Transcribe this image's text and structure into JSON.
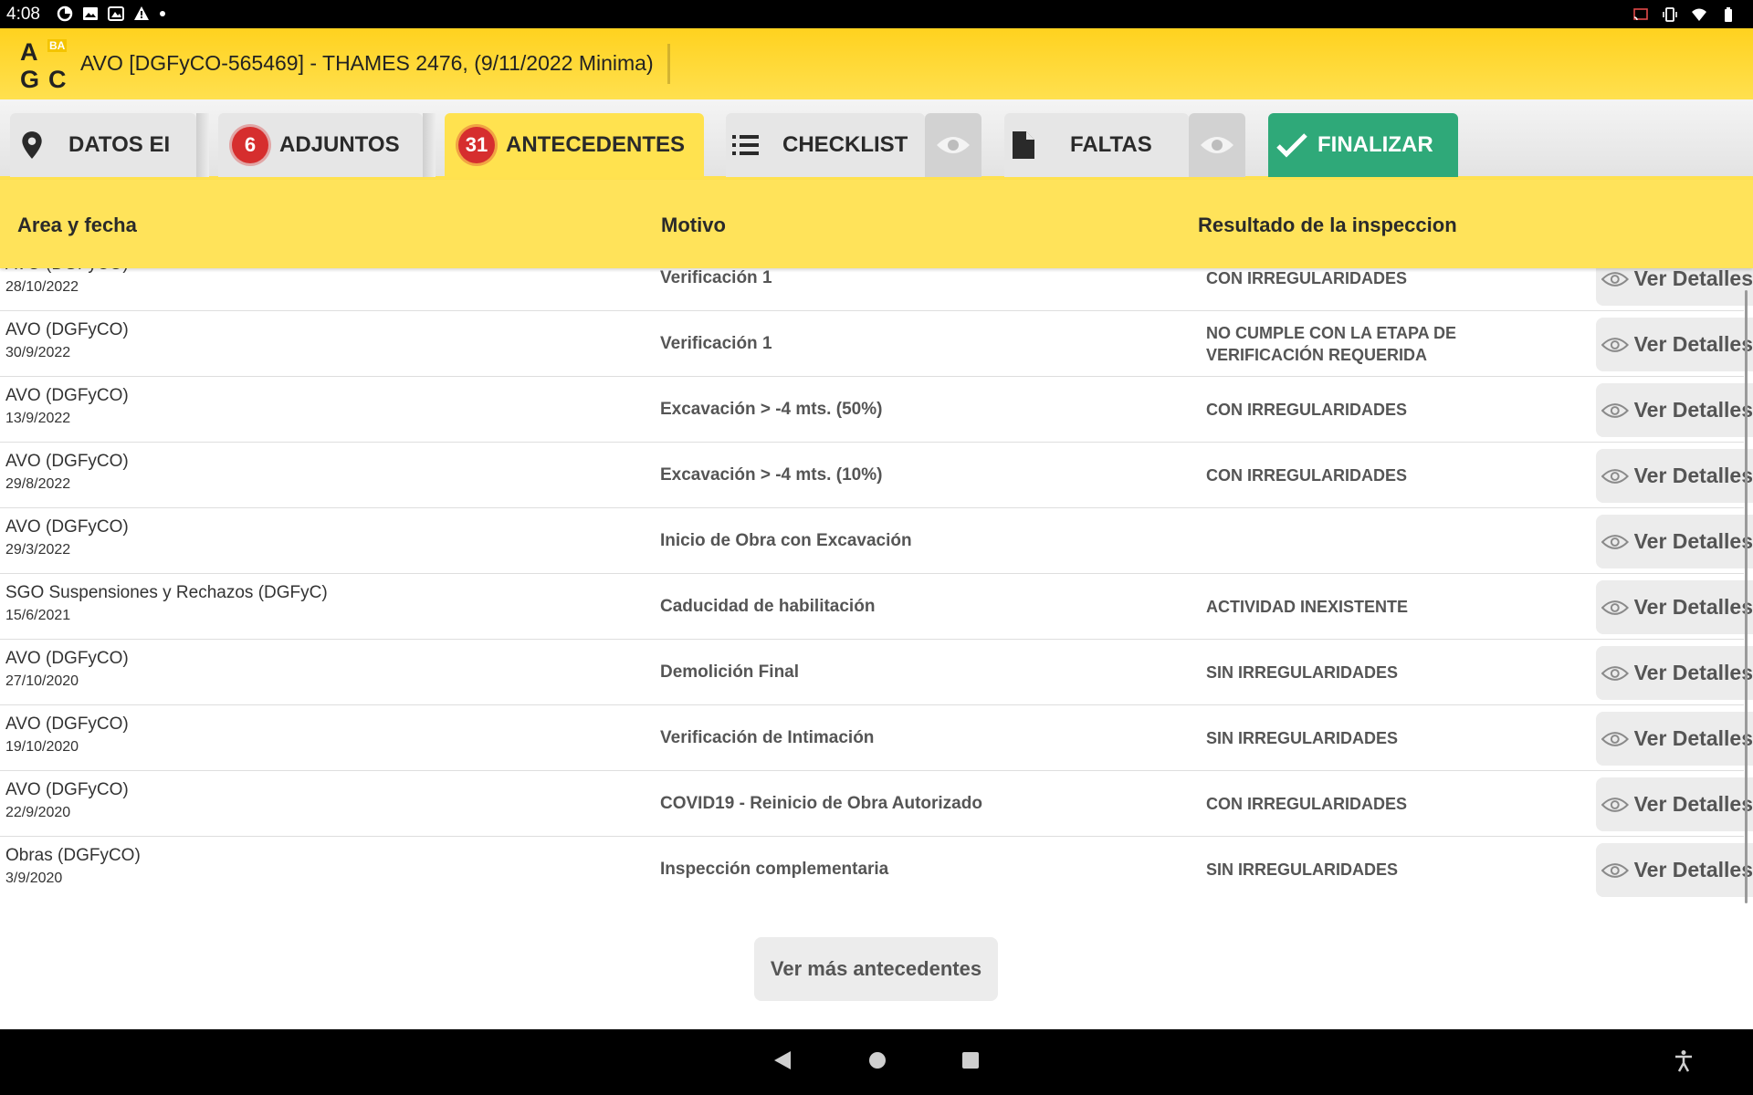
{
  "status_bar": {
    "time": "4:08",
    "left_icons": [
      "data-saver-icon",
      "image-icon",
      "photo-icon",
      "warning-icon",
      "dot-icon"
    ],
    "right_icons": [
      "cast-icon",
      "vibrate-icon",
      "wifi-icon",
      "battery-icon"
    ]
  },
  "app_bar": {
    "logo_letters": [
      "A",
      "G",
      "C"
    ],
    "logo_badge": "BA",
    "title": "AVO [DGFyCO-565469] - THAMES 2476, (9/11/2022 Minima)"
  },
  "tabs": [
    {
      "label": "DATOS EI",
      "icon": "location-pin-icon",
      "active": false
    },
    {
      "label": "ADJUNTOS",
      "badge": "6",
      "active": false
    },
    {
      "label": "ANTECEDENTES",
      "badge": "31",
      "active": true
    },
    {
      "label": "CHECKLIST",
      "icon": "list-icon",
      "active": false,
      "eye": true
    },
    {
      "label": "FALTAS",
      "icon": "document-icon",
      "active": false,
      "eye": true
    },
    {
      "label": "FINALIZAR",
      "icon": "check-icon",
      "active": false
    }
  ],
  "table": {
    "headers": {
      "area_fecha": "Area y fecha",
      "motivo": "Motivo",
      "resultado": "Resultado de la inspeccion"
    },
    "rows": [
      {
        "area": "AVO (DGFyCO)",
        "fecha": "28/10/2022",
        "motivo": "Verificación 1",
        "resultado": "CON IRREGULARIDADES",
        "action": "Ver Detalles"
      },
      {
        "area": "AVO (DGFyCO)",
        "fecha": "30/9/2022",
        "motivo": "Verificación 1",
        "resultado": "NO CUMPLE CON LA ETAPA DE VERIFICACIÓN REQUERIDA",
        "action": "Ver Detalles"
      },
      {
        "area": "AVO (DGFyCO)",
        "fecha": "13/9/2022",
        "motivo": "Excavación > -4 mts. (50%)",
        "resultado": "CON IRREGULARIDADES",
        "action": "Ver Detalles"
      },
      {
        "area": "AVO (DGFyCO)",
        "fecha": "29/8/2022",
        "motivo": "Excavación > -4 mts. (10%)",
        "resultado": "CON IRREGULARIDADES",
        "action": "Ver Detalles"
      },
      {
        "area": "AVO (DGFyCO)",
        "fecha": "29/3/2022",
        "motivo": "Inicio de Obra con Excavación",
        "resultado": "",
        "action": "Ver Detalles"
      },
      {
        "area": "SGO Suspensiones y Rechazos (DGFyC)",
        "fecha": "15/6/2021",
        "motivo": "Caducidad de habilitación",
        "resultado": "ACTIVIDAD INEXISTENTE",
        "action": "Ver Detalles"
      },
      {
        "area": "AVO (DGFyCO)",
        "fecha": "27/10/2020",
        "motivo": "Demolición Final",
        "resultado": "SIN IRREGULARIDADES",
        "action": "Ver Detalles"
      },
      {
        "area": "AVO (DGFyCO)",
        "fecha": "19/10/2020",
        "motivo": "Verificación de Intimación",
        "resultado": "SIN IRREGULARIDADES",
        "action": "Ver Detalles"
      },
      {
        "area": "AVO (DGFyCO)",
        "fecha": "22/9/2020",
        "motivo": "COVID19 - Reinicio de Obra Autorizado",
        "resultado": "CON IRREGULARIDADES",
        "action": "Ver Detalles"
      },
      {
        "area": "Obras (DGFyCO)",
        "fecha": "3/9/2020",
        "motivo": "Inspección complementaria",
        "resultado": "SIN IRREGULARIDADES",
        "action": "Ver Detalles"
      }
    ]
  },
  "more_button": "Ver más antecedentes",
  "nav_bar": {
    "icons": [
      "back-icon",
      "home-icon",
      "recents-icon",
      "accessibility-icon"
    ]
  },
  "colors": {
    "header_yellow": "#ffe35a",
    "active_tab": "#ffe24f",
    "finalizar_green": "#2fa979",
    "badge_red": "#d62e2e"
  }
}
